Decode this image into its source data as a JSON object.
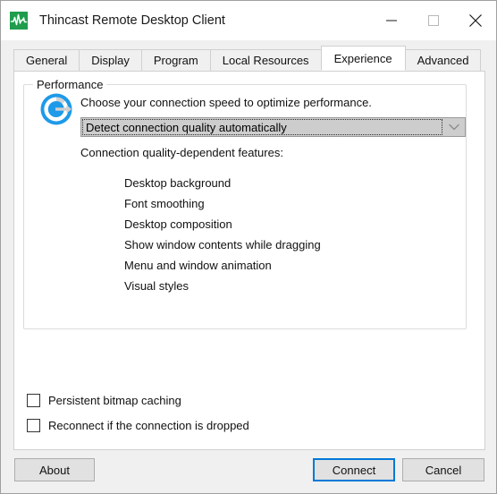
{
  "window": {
    "title": "Thincast Remote Desktop Client",
    "icon": "waveform-icon",
    "controls": {
      "minimize": "minimize-icon",
      "maximize": "maximize-icon",
      "close": "close-icon"
    }
  },
  "tabs": [
    {
      "label": "General",
      "selected": false
    },
    {
      "label": "Display",
      "selected": false
    },
    {
      "label": "Program",
      "selected": false
    },
    {
      "label": "Local Resources",
      "selected": false
    },
    {
      "label": "Experience",
      "selected": true
    },
    {
      "label": "Advanced",
      "selected": false
    }
  ],
  "performance": {
    "group_label": "Performance",
    "icon": "speedometer-icon",
    "prompt": "Choose your connection speed to optimize performance.",
    "connection_speed": {
      "selected": "Detect connection quality automatically",
      "arrow_icon": "chevron-down-icon"
    },
    "features_caption": "Connection quality-dependent features:",
    "features": [
      "Desktop background",
      "Font smoothing",
      "Desktop composition",
      "Show window contents while dragging",
      "Menu and window animation",
      "Visual styles"
    ]
  },
  "options": [
    {
      "label": "Persistent bitmap caching",
      "checked": false
    },
    {
      "label": "Reconnect if the connection is dropped",
      "checked": false
    }
  ],
  "footer": {
    "about": "About",
    "connect": "Connect",
    "cancel": "Cancel"
  },
  "colors": {
    "accent": "#0078d7",
    "icon_green": "#1f9d4d",
    "window_bg": "#f0f0f0",
    "panel_bg": "#ffffff"
  }
}
